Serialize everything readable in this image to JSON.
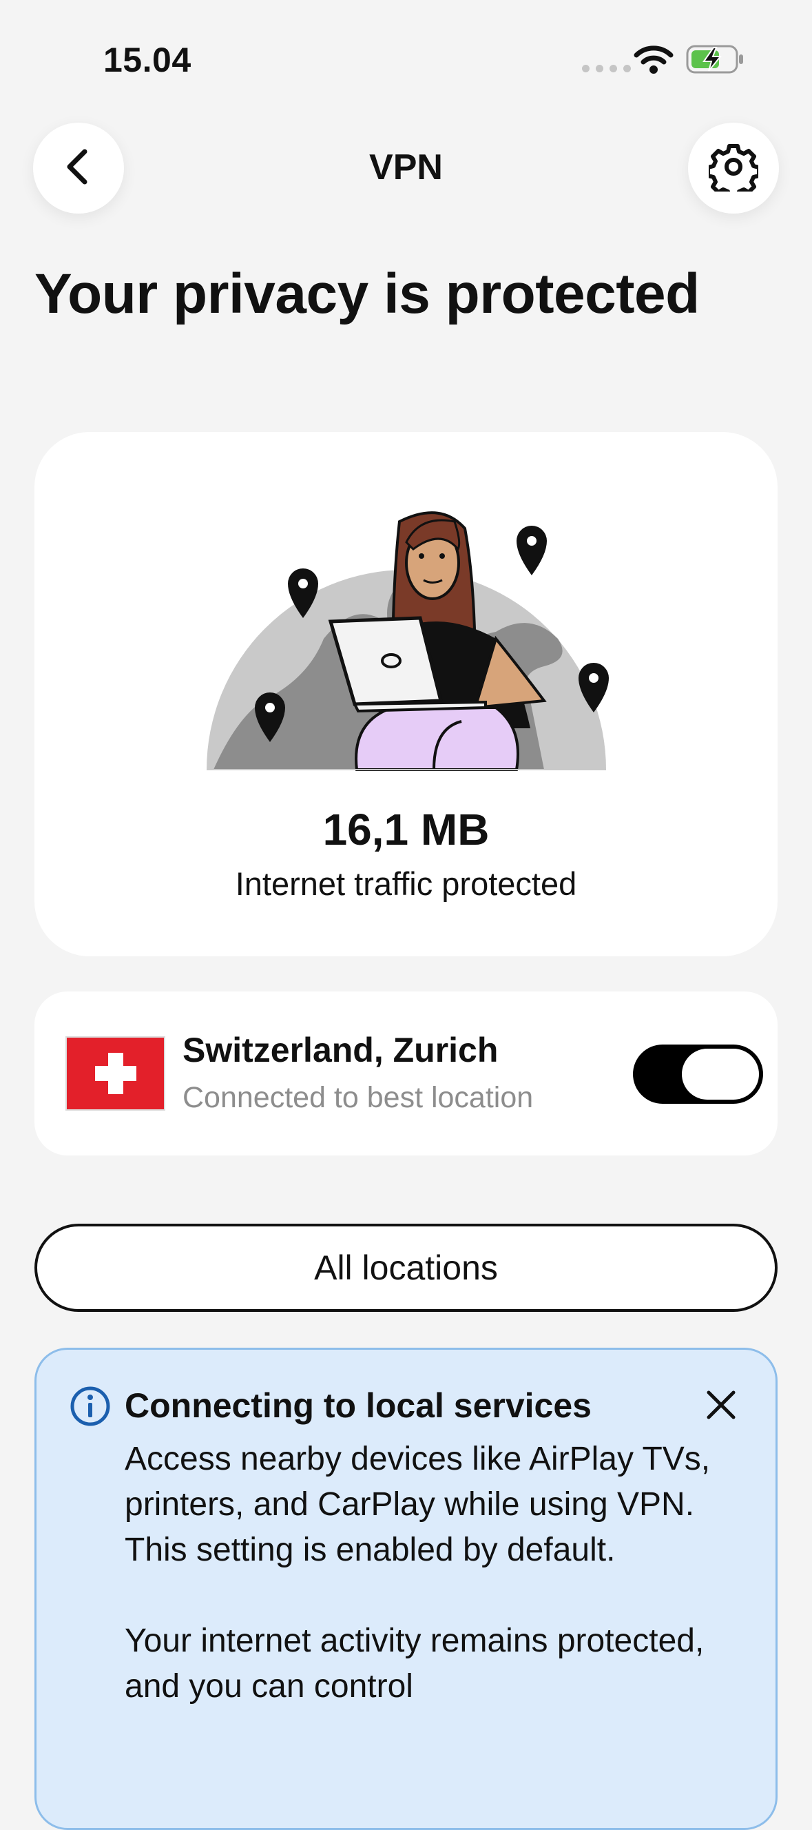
{
  "status_bar": {
    "time": "15.04"
  },
  "header": {
    "title": "VPN",
    "back_icon": "chevron-left-icon",
    "settings_icon": "gear-icon"
  },
  "headline": "Your privacy is protected",
  "protection": {
    "value": "16,1 MB",
    "label": "Internet traffic protected"
  },
  "location": {
    "name": "Switzerland, Zurich",
    "subtitle": "Connected to best location",
    "flag_color": "#e3202a",
    "connected": true
  },
  "all_locations_label": "All locations",
  "info_banner": {
    "title": "Connecting to local services",
    "body": "Access nearby devices like AirPlay TVs, printers, and CarPlay while using VPN. This setting is enabled by default.\n\nYour internet activity remains protected, and you can control",
    "background": "#dcebfb",
    "accent": "#1b5fae"
  }
}
